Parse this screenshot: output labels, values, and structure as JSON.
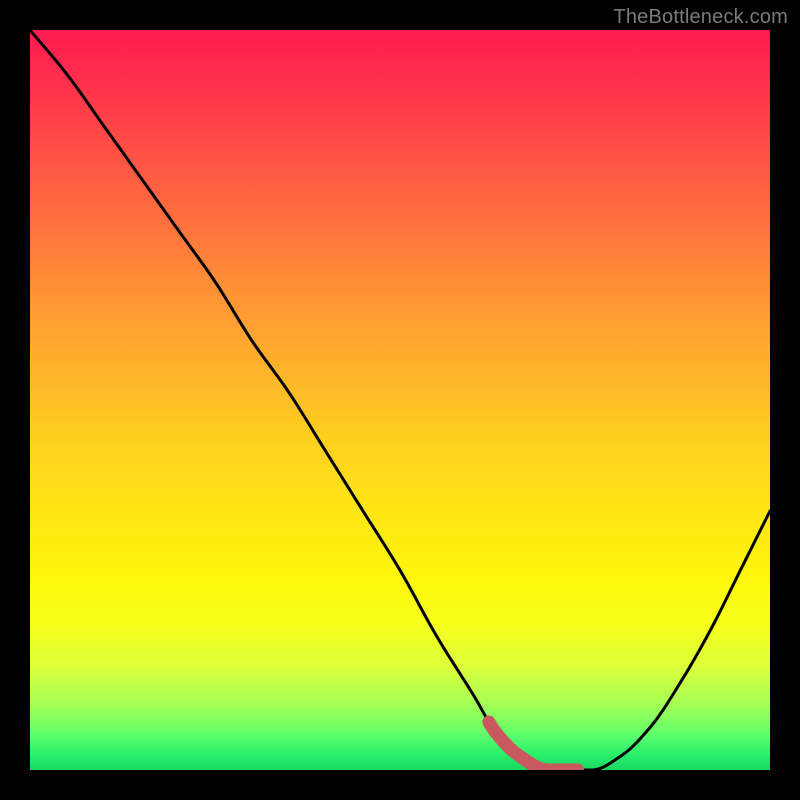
{
  "attribution": "TheBottleneck.com",
  "chart_data": {
    "type": "line",
    "title": "",
    "xlabel": "",
    "ylabel": "",
    "xlim": [
      0,
      100
    ],
    "ylim": [
      0,
      100
    ],
    "x": [
      0,
      5,
      10,
      15,
      20,
      25,
      30,
      35,
      40,
      45,
      50,
      55,
      60,
      63,
      66,
      70,
      73,
      76,
      80,
      84,
      88,
      92,
      96,
      100
    ],
    "values": [
      100,
      94,
      87,
      80,
      73,
      66,
      58,
      51,
      43,
      35,
      27,
      18,
      10,
      5,
      2,
      0,
      0,
      0,
      2,
      6,
      12,
      19,
      27,
      35
    ],
    "highlight_range_x": [
      62,
      74
    ],
    "gradient_stops": [
      {
        "pos": 0.0,
        "color": "#ff1a50"
      },
      {
        "pos": 0.1,
        "color": "#ff3a4a"
      },
      {
        "pos": 0.24,
        "color": "#ff6a3f"
      },
      {
        "pos": 0.38,
        "color": "#ff9a33"
      },
      {
        "pos": 0.56,
        "color": "#ffd21f"
      },
      {
        "pos": 0.66,
        "color": "#ffe713"
      },
      {
        "pos": 0.74,
        "color": "#fff60a"
      },
      {
        "pos": 0.8,
        "color": "#f7ff1a"
      },
      {
        "pos": 0.86,
        "color": "#dcff3a"
      },
      {
        "pos": 0.91,
        "color": "#a6ff55"
      },
      {
        "pos": 0.95,
        "color": "#62ff6a"
      },
      {
        "pos": 0.98,
        "color": "#28f06c"
      },
      {
        "pos": 1.0,
        "color": "#18d861"
      }
    ],
    "curve_color": "#000000",
    "highlight_color": "#c9595f"
  }
}
